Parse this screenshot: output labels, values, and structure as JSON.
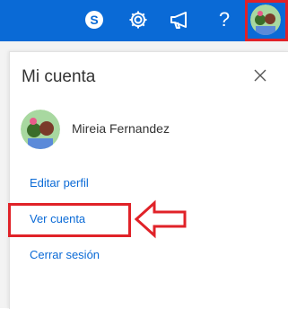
{
  "topbar": {
    "icons": [
      "skype-icon",
      "gear-icon",
      "megaphone-icon",
      "help-icon",
      "avatar"
    ],
    "help_glyph": "?"
  },
  "panel": {
    "title": "Mi cuenta",
    "user_name": "Mireia Fernandez",
    "links": {
      "edit_profile": "Editar perfil",
      "view_account": "Ver cuenta",
      "sign_out": "Cerrar sesión"
    }
  },
  "colors": {
    "topbar": "#0a6ad6",
    "link": "#0a6ad6",
    "highlight": "#e02228"
  }
}
